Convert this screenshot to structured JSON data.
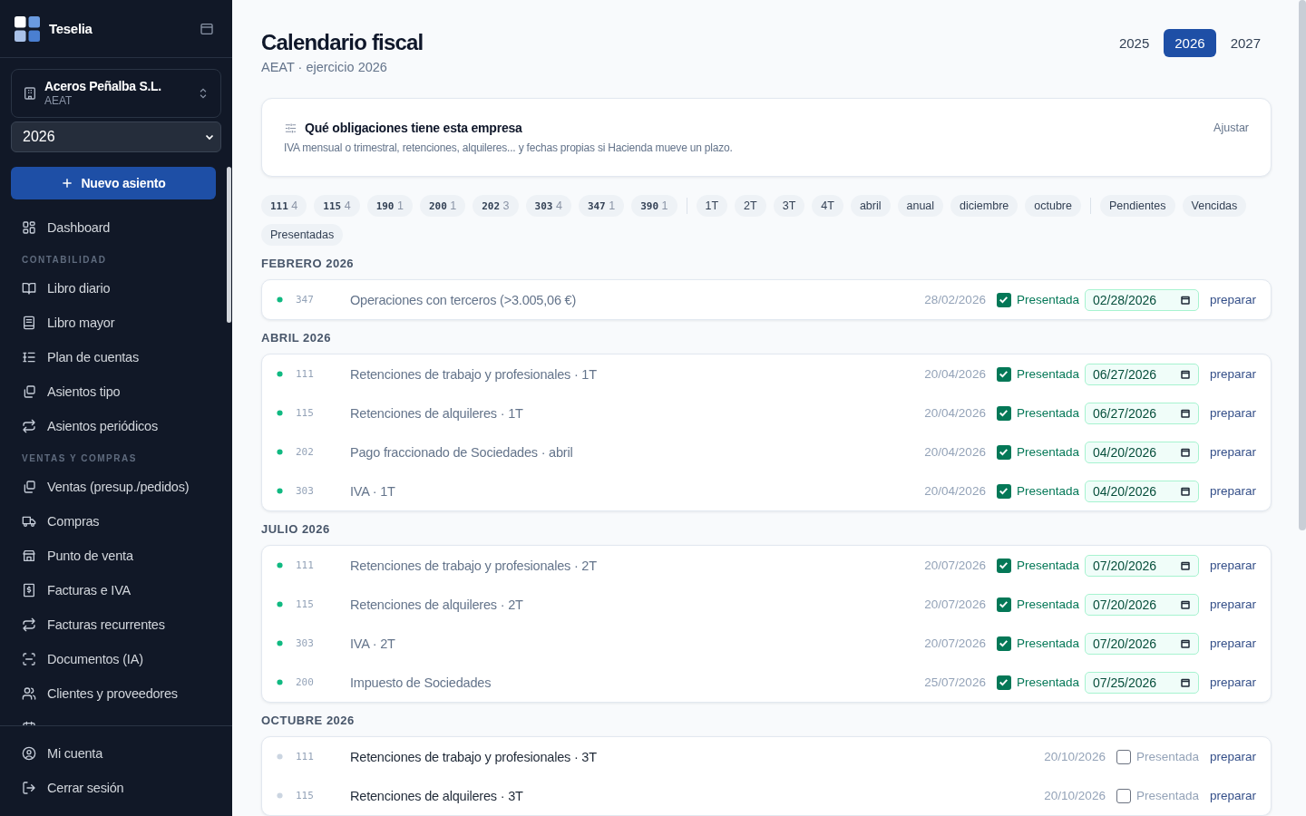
{
  "sidebar": {
    "brand": "Teselia",
    "company": {
      "name": "Aceros Peñalba S.L.",
      "subtitle": "AEAT"
    },
    "year_select": "2026",
    "new_button": "Nuevo asiento",
    "nav": [
      {
        "kind": "item",
        "label": "Dashboard"
      },
      {
        "kind": "heading",
        "label": "CONTABILIDAD"
      },
      {
        "kind": "item",
        "label": "Libro diario"
      },
      {
        "kind": "item",
        "label": "Libro mayor"
      },
      {
        "kind": "item",
        "label": "Plan de cuentas"
      },
      {
        "kind": "item",
        "label": "Asientos tipo"
      },
      {
        "kind": "item",
        "label": "Asientos periódicos"
      },
      {
        "kind": "heading",
        "label": "VENTAS Y COMPRAS"
      },
      {
        "kind": "item",
        "label": "Ventas (presup./pedidos)"
      },
      {
        "kind": "item",
        "label": "Compras"
      },
      {
        "kind": "item",
        "label": "Punto de venta"
      },
      {
        "kind": "item",
        "label": "Facturas e IVA"
      },
      {
        "kind": "item",
        "label": "Facturas recurrentes"
      },
      {
        "kind": "item",
        "label": "Documentos (IA)"
      },
      {
        "kind": "item",
        "label": "Clientes y proveedores"
      }
    ],
    "footer": [
      {
        "label": "Mi cuenta"
      },
      {
        "label": "Cerrar sesión"
      }
    ]
  },
  "header": {
    "title": "Calendario fiscal",
    "subtitle": "AEAT · ejercicio 2026",
    "years": [
      {
        "label": "2025",
        "selected": false
      },
      {
        "label": "2026",
        "selected": true
      },
      {
        "label": "2027",
        "selected": false
      }
    ]
  },
  "obligations": {
    "title": "Qué obligaciones tiene esta empresa",
    "text": "IVA mensual o trimestral, retenciones, alquileres... y fechas propias si Hacienda mueve un plazo.",
    "action": "Ajustar"
  },
  "filters": [
    {
      "kind": "form",
      "chips": [
        {
          "code": "111",
          "count": "4"
        },
        {
          "code": "115",
          "count": "4"
        },
        {
          "code": "190",
          "count": "1"
        },
        {
          "code": "200",
          "count": "1"
        },
        {
          "code": "202",
          "count": "3"
        },
        {
          "code": "303",
          "count": "4"
        },
        {
          "code": "347",
          "count": "1"
        },
        {
          "code": "390",
          "count": "1"
        }
      ]
    },
    {
      "kind": "period",
      "chips": [
        {
          "label": "1T"
        },
        {
          "label": "2T"
        },
        {
          "label": "3T"
        },
        {
          "label": "4T"
        },
        {
          "label": "abril"
        },
        {
          "label": "anual"
        },
        {
          "label": "diciembre"
        },
        {
          "label": "octubre"
        }
      ]
    },
    {
      "kind": "status",
      "chips": [
        {
          "label": "Pendientes"
        },
        {
          "label": "Vencidas"
        },
        {
          "label": "Presentadas"
        }
      ]
    }
  ],
  "sections": [
    {
      "month": "FEBRERO 2026",
      "rows": [
        {
          "code": "347",
          "title": "Operaciones con terceros (>3.005,06 €)",
          "due": "28/02/2026",
          "filed": true,
          "status": "Presentada",
          "filed_date": "02/28/2026",
          "action": "preparar"
        }
      ]
    },
    {
      "month": "ABRIL 2026",
      "rows": [
        {
          "code": "111",
          "title": "Retenciones de trabajo y profesionales · 1T",
          "due": "20/04/2026",
          "filed": true,
          "status": "Presentada",
          "filed_date": "06/27/2026",
          "action": "preparar"
        },
        {
          "code": "115",
          "title": "Retenciones de alquileres · 1T",
          "due": "20/04/2026",
          "filed": true,
          "status": "Presentada",
          "filed_date": "06/27/2026",
          "action": "preparar"
        },
        {
          "code": "202",
          "title": "Pago fraccionado de Sociedades · abril",
          "due": "20/04/2026",
          "filed": true,
          "status": "Presentada",
          "filed_date": "04/20/2026",
          "action": "preparar"
        },
        {
          "code": "303",
          "title": "IVA · 1T",
          "due": "20/04/2026",
          "filed": true,
          "status": "Presentada",
          "filed_date": "04/20/2026",
          "action": "preparar"
        }
      ]
    },
    {
      "month": "JULIO 2026",
      "rows": [
        {
          "code": "111",
          "title": "Retenciones de trabajo y profesionales · 2T",
          "due": "20/07/2026",
          "filed": true,
          "status": "Presentada",
          "filed_date": "07/20/2026",
          "action": "preparar"
        },
        {
          "code": "115",
          "title": "Retenciones de alquileres · 2T",
          "due": "20/07/2026",
          "filed": true,
          "status": "Presentada",
          "filed_date": "07/20/2026",
          "action": "preparar"
        },
        {
          "code": "303",
          "title": "IVA · 2T",
          "due": "20/07/2026",
          "filed": true,
          "status": "Presentada",
          "filed_date": "07/20/2026",
          "action": "preparar"
        },
        {
          "code": "200",
          "title": "Impuesto de Sociedades",
          "due": "25/07/2026",
          "filed": true,
          "status": "Presentada",
          "filed_date": "07/25/2026",
          "action": "preparar"
        }
      ]
    },
    {
      "month": "OCTUBRE 2026",
      "rows": [
        {
          "code": "111",
          "title": "Retenciones de trabajo y profesionales · 3T",
          "due": "20/10/2026",
          "filed": false,
          "status": "Presentada",
          "action": "preparar"
        },
        {
          "code": "115",
          "title": "Retenciones de alquileres · 3T",
          "due": "20/10/2026",
          "filed": false,
          "status": "Presentada",
          "action": "preparar"
        }
      ]
    }
  ]
}
